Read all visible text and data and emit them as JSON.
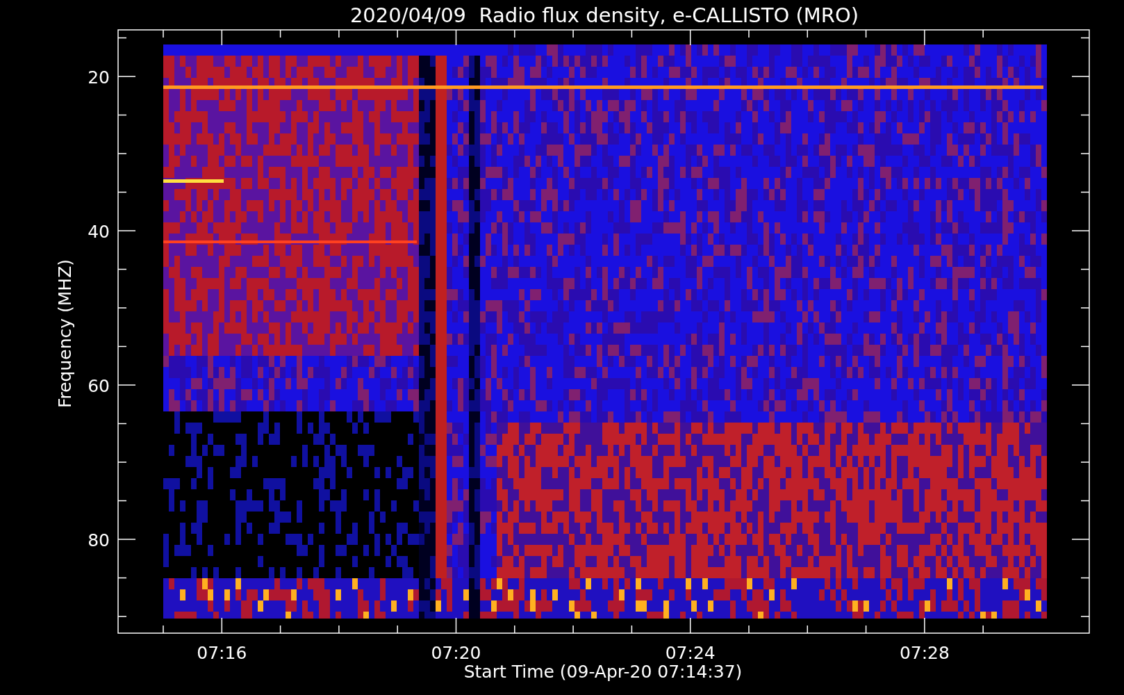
{
  "title": "2020/04/09  Radio flux density, e-CALLISTO (MRO)",
  "y_axis": {
    "label": "Frequency (MHZ)",
    "ticks": [
      "20",
      "40",
      "60",
      "80"
    ]
  },
  "x_axis": {
    "label": "Start Time (09-Apr-20 07:14:37)",
    "ticks": [
      "07:16",
      "07:20",
      "07:24",
      "07:28"
    ]
  }
}
